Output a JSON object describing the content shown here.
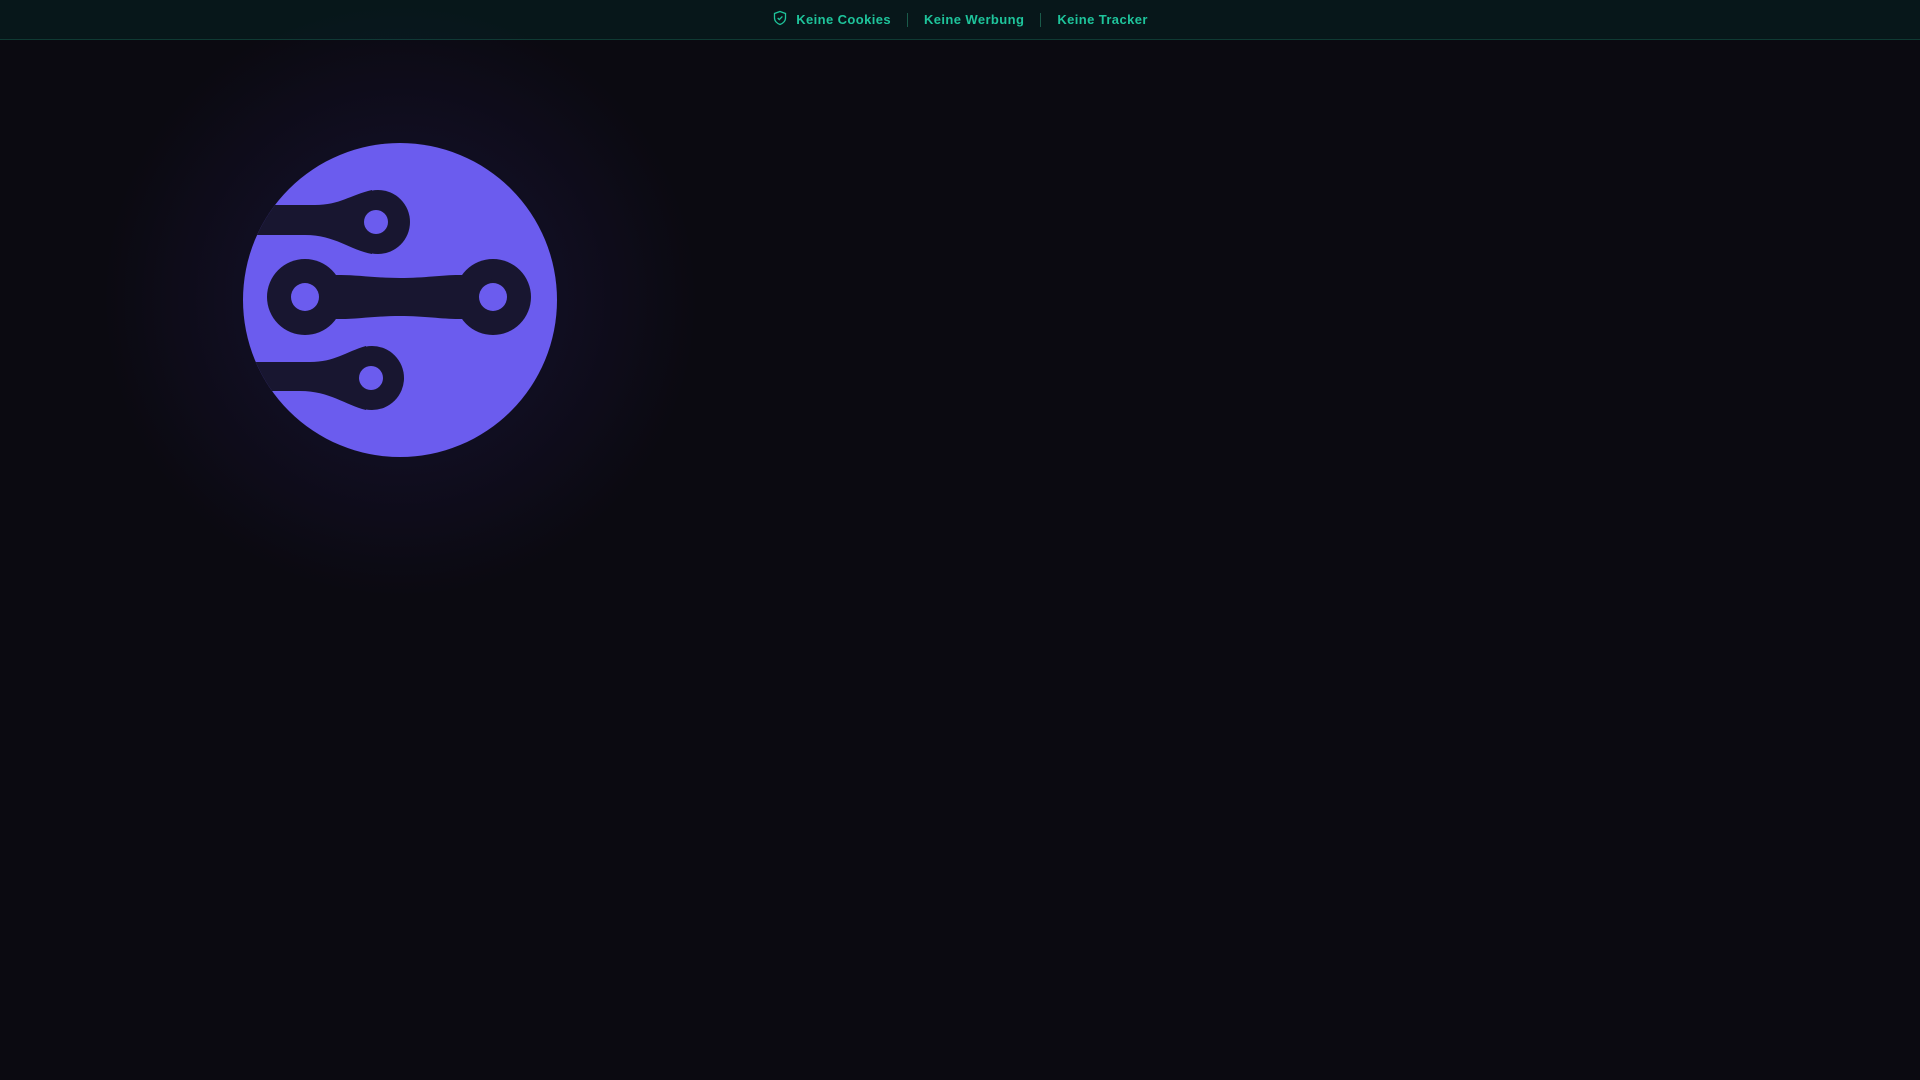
{
  "topbar": {
    "icon": "shield-check-icon",
    "items": [
      "Keine Cookies",
      "Keine Werbung",
      "Keine Tracker"
    ]
  },
  "colors": {
    "accent": "#1ec49b",
    "logo": "#6b5cee",
    "background": "#0b0a11"
  },
  "logo": {
    "icon": "network-globe-logo"
  }
}
